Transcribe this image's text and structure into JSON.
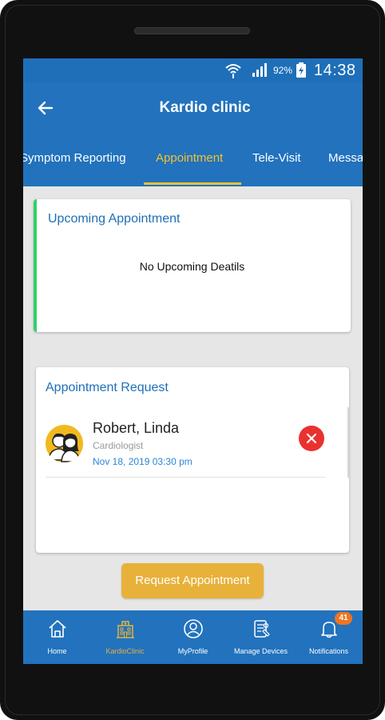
{
  "status_bar": {
    "battery_percent": "92%",
    "time": "14:38"
  },
  "app_bar": {
    "title": "Kardio clinic"
  },
  "tabs": [
    {
      "label": "Symptom Reporting",
      "active": false
    },
    {
      "label": "Appointment",
      "active": true
    },
    {
      "label": "Tele-Visit",
      "active": false
    },
    {
      "label": "Messa",
      "active": false
    }
  ],
  "upcoming": {
    "title": "Upcoming Appointment",
    "empty_text": "No Upcoming Deatils"
  },
  "requests": {
    "title": "Appointment Request",
    "items": [
      {
        "name": "Robert, Linda",
        "role": "Cardiologist",
        "datetime": "Nov 18, 2019  03:30 pm"
      }
    ]
  },
  "request_button": {
    "label": "Request Appointment"
  },
  "bottom_nav": {
    "items": [
      {
        "label": "Home",
        "icon": "home-icon",
        "active": false
      },
      {
        "label": "KardioClinic",
        "icon": "clinic-icon",
        "active": true
      },
      {
        "label": "MyProfile",
        "icon": "profile-icon",
        "active": false
      },
      {
        "label": "Manage Devices",
        "icon": "devices-icon",
        "active": false
      },
      {
        "label": "Notifications",
        "icon": "bell-icon",
        "active": false
      }
    ],
    "notification_count": "41"
  },
  "colors": {
    "primary": "#2272bd",
    "accent": "#f2c230",
    "button": "#e8b13a",
    "cancel": "#e8322f",
    "upcoming_accent": "#2ed36a"
  }
}
